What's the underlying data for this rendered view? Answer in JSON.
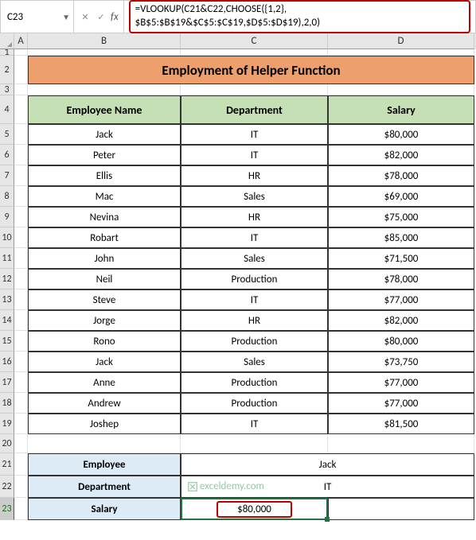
{
  "name_box": "C23",
  "formula": "=VLOOKUP(C21&C22,CHOOSE({1,2}, $B$5:$B$19&$C$5:$C$19,$D$5:$D$19),2,0)",
  "columns": [
    "A",
    "B",
    "C",
    "D"
  ],
  "title": "Employment of Helper Function",
  "headers": {
    "b": "Employee Name",
    "c": "Department",
    "d": "Salary"
  },
  "rows": [
    {
      "n": "5",
      "b": "Jack",
      "c": "IT",
      "d": "$80,000"
    },
    {
      "n": "6",
      "b": "Peter",
      "c": "IT",
      "d": "$82,000"
    },
    {
      "n": "7",
      "b": "Ellis",
      "c": "HR",
      "d": "$78,000"
    },
    {
      "n": "8",
      "b": "Mac",
      "c": "Sales",
      "d": "$69,000"
    },
    {
      "n": "9",
      "b": "Nevina",
      "c": "HR",
      "d": "$75,000"
    },
    {
      "n": "10",
      "b": "Robart",
      "c": "IT",
      "d": "$85,000"
    },
    {
      "n": "11",
      "b": "John",
      "c": "Sales",
      "d": "$71,500"
    },
    {
      "n": "12",
      "b": "Neil",
      "c": "Production",
      "d": "$78,000"
    },
    {
      "n": "13",
      "b": "Steve",
      "c": "IT",
      "d": "$77,000"
    },
    {
      "n": "14",
      "b": "Jorge",
      "c": "HR",
      "d": "$82,000"
    },
    {
      "n": "15",
      "b": "Rono",
      "c": "Production",
      "d": "$80,000"
    },
    {
      "n": "16",
      "b": "Jack",
      "c": "Sales",
      "d": "$73,750"
    },
    {
      "n": "17",
      "b": "Anne",
      "c": "Production",
      "d": "$77,000"
    },
    {
      "n": "18",
      "b": "Andrew",
      "c": "Production",
      "d": "$77,000"
    },
    {
      "n": "19",
      "b": "Joshep",
      "c": "IT",
      "d": "$81,500"
    }
  ],
  "lookup": {
    "employee_label": "Employee",
    "employee_value": "Jack",
    "department_label": "Department",
    "department_value": "IT",
    "salary_label": "Salary",
    "salary_value": "$80,000"
  },
  "row_nums": {
    "r1": "1",
    "r2": "2",
    "r3": "3",
    "r4": "4",
    "r20": "20",
    "r21": "21",
    "r22": "22",
    "r23": "23"
  },
  "watermark": "exceldemy.com"
}
